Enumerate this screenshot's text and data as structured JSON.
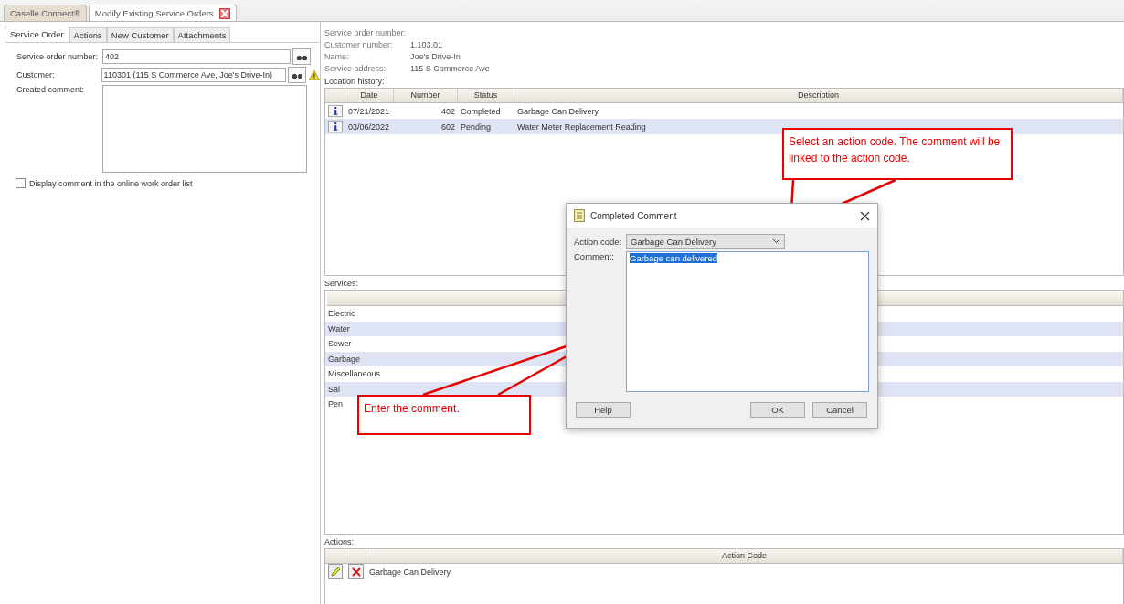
{
  "tabs": [
    {
      "label": "Caselle Connect®",
      "selected": false,
      "closable": false
    },
    {
      "label": "Modify Existing Service Orders",
      "selected": true,
      "closable": true
    }
  ],
  "subtabs": [
    {
      "label": "Service Order",
      "selected": true
    },
    {
      "label": "Actions",
      "selected": false
    },
    {
      "label": "New Customer",
      "selected": false
    },
    {
      "label": "Attachments",
      "selected": false
    }
  ],
  "form": {
    "service_order_label": "Service order number:",
    "service_order_value": "402",
    "customer_label": "Customer:",
    "customer_value": "110301 (115 S Commerce Ave, Joe's Drive-In)",
    "customer_warning": true,
    "comment_label": "Created comment:",
    "display_checkbox": {
      "label": "Display comment in the online work order list",
      "checked": false
    }
  },
  "details": [
    {
      "label": "Service order number:"
    },
    {
      "label": "Customer number:",
      "value": "1.103.01"
    },
    {
      "label": "Name:",
      "value": "Joe's Drive-In"
    },
    {
      "label": "Service address:",
      "value": "115 S Commerce Ave"
    }
  ],
  "location_history": {
    "label": "Location history:",
    "columns": [
      "Date",
      "Number",
      "Status",
      "Description"
    ],
    "rows": [
      {
        "date": "07/21/2021",
        "number": "402",
        "status": "Completed",
        "description": "Garbage Can Delivery",
        "selected": false
      },
      {
        "date": "03/06/2022",
        "number": "602",
        "status": "Pending",
        "description": "Water Meter Replacement Reading",
        "selected": true
      }
    ]
  },
  "services": {
    "label": "Services:",
    "items": [
      "Electric",
      "Water",
      "Sewer",
      "Garbage",
      "Miscellaneous",
      "Sal",
      "Pen"
    ]
  },
  "actions": {
    "label": "Actions:",
    "column": "Action Code",
    "rows": [
      {
        "action_code": "Garbage Can Delivery"
      }
    ]
  },
  "dialog": {
    "title": "Completed Comment",
    "action_code_label": "Action code:",
    "action_code_value": "Garbage Can Delivery",
    "comment_label": "Comment:",
    "comment_value": "Garbage can delivered",
    "comment_selected": true,
    "buttons": [
      "Help",
      "OK",
      "Cancel"
    ]
  },
  "callouts": [
    {
      "text": "Select an action code. The comment will be linked to the action code."
    },
    {
      "text": "Enter the comment."
    }
  ]
}
